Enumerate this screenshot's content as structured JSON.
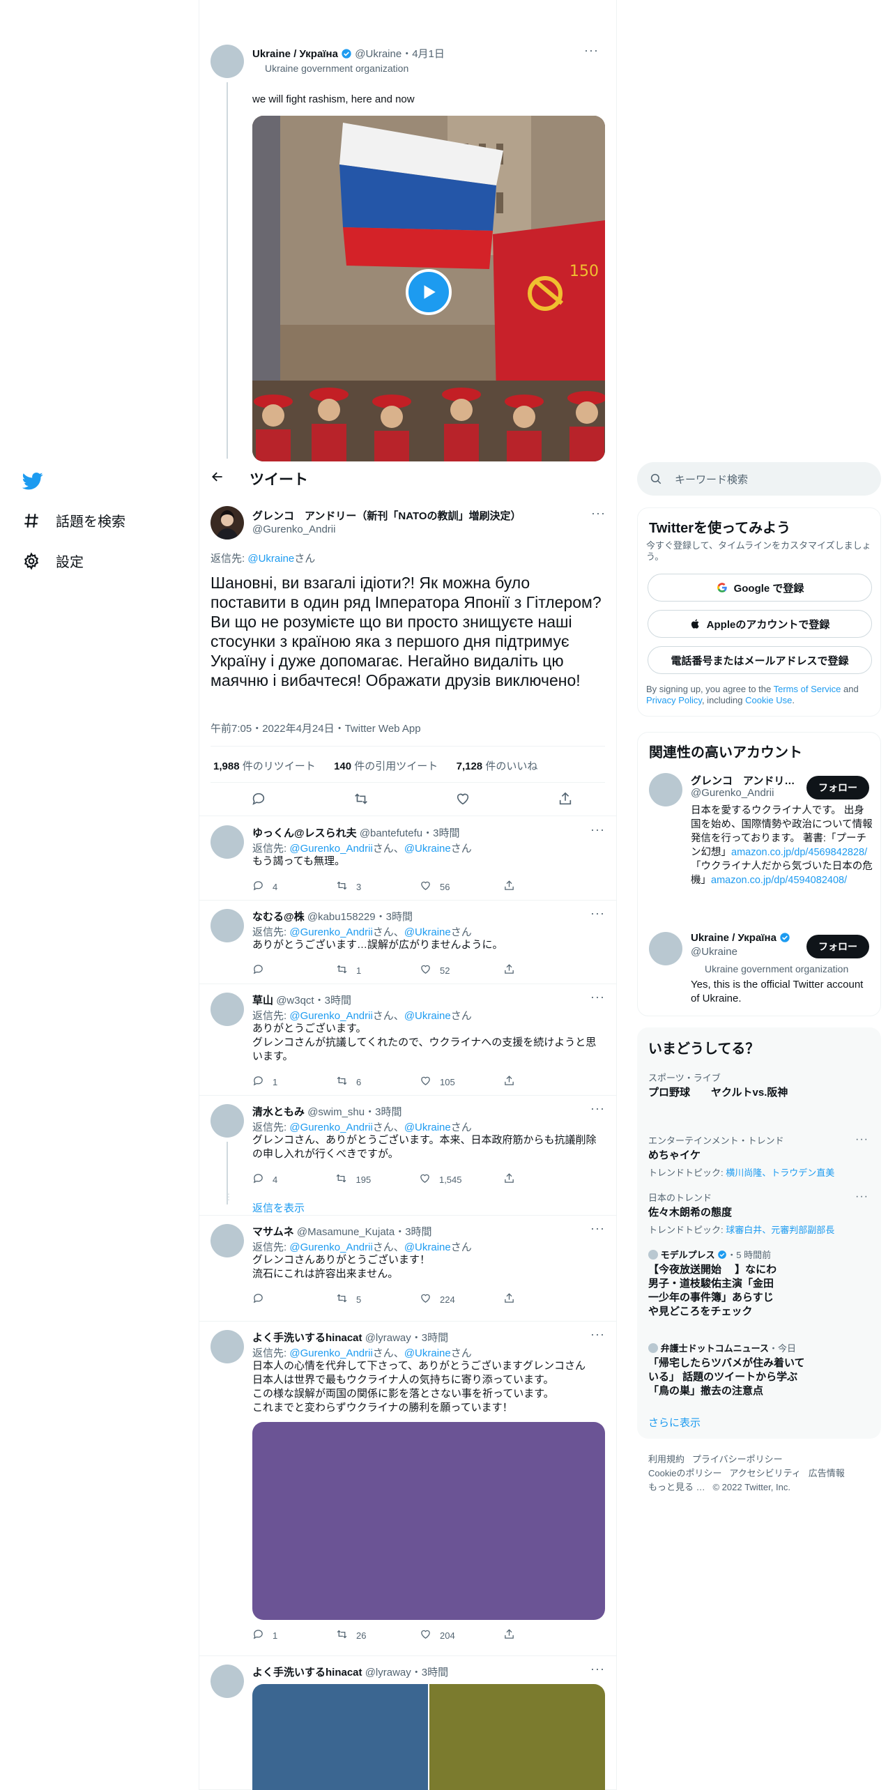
{
  "nav": {
    "explore": "話題を検索",
    "settings": "設定"
  },
  "quoted_tweet": {
    "name": "Ukraine / Україна",
    "handle": "@Ukraine",
    "date": "・4月1日",
    "org": "Ukraine government organization",
    "text": "we will fight rashism, here and now"
  },
  "header": {
    "title": "ツイート"
  },
  "main_tweet": {
    "name": "グレンコ　アンドリー（新刊「NATOの教訓」増刷決定）",
    "handle": "@Gurenko_Andrii",
    "reply_label": "返信先: ",
    "reply_to": "@Ukraine",
    "reply_suffix": "さん",
    "text": "Шановні, ви взагалі ідіоти?! Як можна було поставити в один ряд Імператора Японії з Гітлером? Ви що не розумієте що ви просто знищуєте наші стосунки з країною яка з першого дня підтримує Україну і дуже допомагає. Негайно видаліть цю маячню і вибачтеся! Ображати друзів виключено!",
    "meta": "午前7:05・2022年4月24日・Twitter Web App",
    "retweets_count": "1,988",
    "retweets_label": " 件のリツイート",
    "quotes_count": "140",
    "quotes_label": " 件の引用ツイート",
    "likes_count": "7,128",
    "likes_label": " 件のいいね"
  },
  "replies": [
    {
      "name": "ゆっくん@レスられ夫",
      "handle": "@bantefutefu",
      "time": "・3時間",
      "text": "もう謁っても無理。",
      "reply_count": "4",
      "retweet_count": "3",
      "like_count": "56"
    },
    {
      "name": "なむる@株",
      "handle": "@kabu158229",
      "time": "・3時間",
      "text": "ありがとうございます…誤解が広がりませんように。",
      "reply_count": "",
      "retweet_count": "1",
      "like_count": "52"
    },
    {
      "name": "草山",
      "handle": "@w3qct",
      "time": "・3時間",
      "text": "ありがとうございます。\nグレンコさんが抗議してくれたので、ウクライナへの支援を続けようと思います。",
      "reply_count": "1",
      "retweet_count": "6",
      "like_count": "105"
    },
    {
      "name": "清水ともみ",
      "handle": "@swim_shu",
      "time": "・3時間",
      "text": "グレンコさん、ありがとうございます。本来、日本政府筋からも抗議削除の申し入れが行くべきですが。",
      "reply_count": "4",
      "retweet_count": "195",
      "like_count": "1,545"
    },
    {
      "name": "マサムネ",
      "handle": "@Masamune_Kujata",
      "time": "・3時間",
      "text": "グレンコさんありがとうございます！\n流石にこれは許容出来ません。",
      "reply_count": "",
      "retweet_count": "5",
      "like_count": "224"
    },
    {
      "name": "よく手洗いするhinacat",
      "handle": "@lyraway",
      "time": "・3時間",
      "text": "日本人の心情を代弁して下さって、ありがとうございますグレンコさん\n日本人は世界で最もウクライナ人の気持ちに寄り添っています。\nこの様な誤解が両国の関係に影を落とさない事を祈っています。\nこれまでと変わらずウクライナの勝利を願っています！",
      "reply_count": "1",
      "retweet_count": "26",
      "like_count": "204"
    },
    {
      "name": "よく手洗いするhinacat",
      "handle": "@lyraway",
      "time": "・3時間"
    }
  ],
  "reply_common": {
    "label": "返信先: ",
    "to1": "@Gurenko_Andrii",
    "sep": "さん、",
    "to2": "@Ukraine",
    "suffix": "さん"
  },
  "show_replies": "返信を表示",
  "search": {
    "placeholder": "キーワード検索"
  },
  "signup": {
    "title": "Twitterを使ってみよう",
    "subtitle": "今すぐ登録して、タイムラインをカスタマイズしましょう。",
    "google": "Google で登録",
    "apple": "Appleのアカウントで登録",
    "phone": "電話番号またはメールアドレスで登録",
    "terms_prefix": "By signing up, you agree to the ",
    "terms_link": "Terms of Service",
    "terms_and": " and ",
    "privacy_link": "Privacy Policy",
    "terms_including": ", including ",
    "cookie_link": "Cookie Use",
    "terms_end": "."
  },
  "relevant": {
    "title": "関連性の高いアカウント",
    "follow_label": "フォロー",
    "acc1_name": "グレンコ　アンドリ…",
    "acc1_handle": "@Gurenko_Andrii",
    "acc1_bio1": "日本を愛するウクライナ人です。 出身国を始め、国際情勢や政治について情報発信を行っております。 著書:「プーチン幻想」",
    "acc1_link1": "amazon.co.jp/dp/4569842828/",
    "acc1_bio2": "「ウクライナ人だから気づいた日本の危機」",
    "acc1_link2": "amazon.co.jp/dp/4594082408/",
    "acc2_name": "Ukraine / Україна",
    "acc2_handle": "@Ukraine",
    "acc2_org": "Ukraine government organization",
    "acc2_bio": "Yes, this is the official Twitter account of Ukraine."
  },
  "trends": {
    "title": "いまどうしてる？",
    "t1_cat": "スポーツ・ライブ",
    "t1_name": "プロ野球　　ヤクルトvs.阪神",
    "t2_cat": "エンターテインメント・トレンド",
    "t2_name": "めちゃイケ",
    "t2_sub_label": "トレンドトピック: ",
    "t2_sub_links": "横川尚隆、トラウデン直美",
    "t3_cat": "日本のトレンド",
    "t3_name": "佐々木朗希の態度",
    "t3_sub_label": "トレンドトピック: ",
    "t3_sub_links": "球審白井、元審判部副部長",
    "t4_src": "モデルプレス",
    "t4_time": "・5 時間前",
    "t4_name": "【今夜放送開始　 】なにわ男子・道枝駿佑主演「金田一少年の事件簿」あらすじや見どころをチェック",
    "t5_src": "弁護士ドットコムニュース",
    "t5_time": "・今日",
    "t5_name": "「帰宅したらツバメが住み着いている」 話題のツイートから学ぶ「鳥の巣」撤去の注意点",
    "more": "さらに表示"
  },
  "footer": {
    "line1a": "利用規約",
    "line1b": "プライバシーポリシー",
    "line2a": "Cookieのポリシー",
    "line2b": "アクセシビリティ",
    "line2c": "広告情報",
    "line3a": "もっと見る …",
    "line3b": "© 2022 Twitter, Inc."
  },
  "colors": {
    "accent": "#1d9bf0",
    "dark": "#0f1419",
    "muted": "#536471",
    "media_purple": "#6b5495",
    "media_blue": "#3b6691",
    "media_olive": "#7b7b2e"
  }
}
